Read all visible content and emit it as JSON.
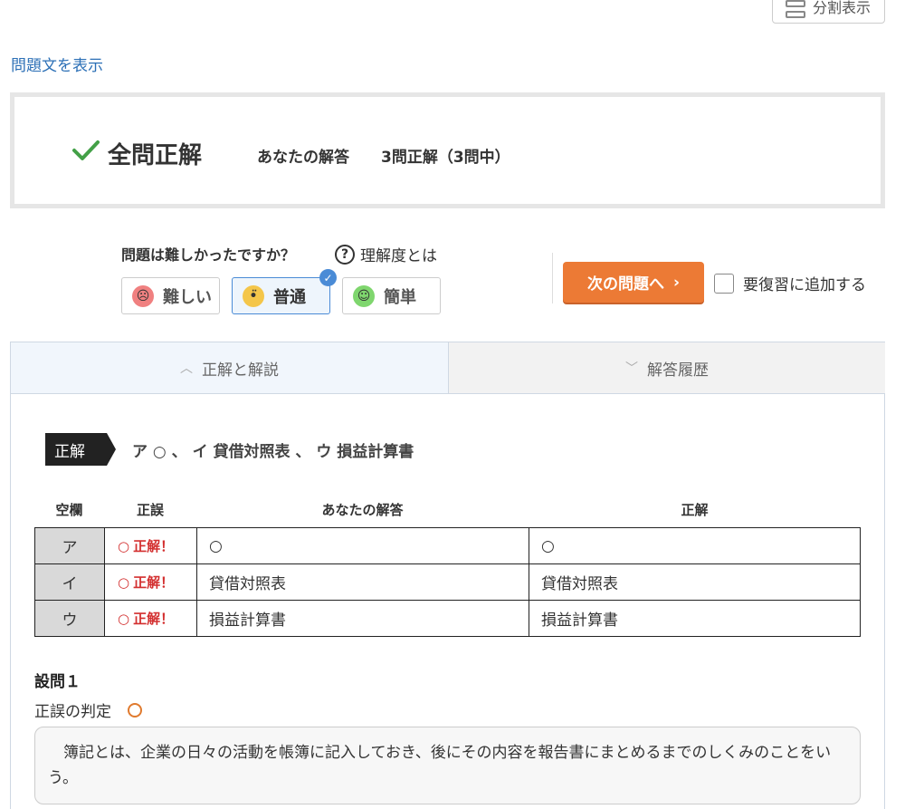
{
  "header": {
    "split_view_label": "分割表示",
    "show_question_link": "問題文を表示"
  },
  "result": {
    "title": "全問正解",
    "your_answer_label": "あなたの解答",
    "your_answer_value": "3問正解（3問中）"
  },
  "difficulty": {
    "question": "問題は難しかったですか？",
    "understanding_link": "理解度とは",
    "options": [
      {
        "label": "難しい",
        "face": "☹"
      },
      {
        "label": "普通",
        "face": "•̈"
      },
      {
        "label": "簡単",
        "face": "☺"
      }
    ],
    "selected": "普通"
  },
  "actions": {
    "next_button": "次の問題へ",
    "review_label": "要復習に追加する"
  },
  "tabs": [
    {
      "label": "正解と解説",
      "active": true
    },
    {
      "label": "解答履歴",
      "active": false
    }
  ],
  "answer": {
    "tag": "正解",
    "text": "ア ○ 、 イ 貸借対照表 、 ウ 損益計算書"
  },
  "table": {
    "headers": [
      "空欄",
      "正誤",
      "あなたの解答",
      "正解"
    ],
    "rows": [
      {
        "blank": "ア",
        "mark": "○",
        "judge": "正解！",
        "yours": "○",
        "correct": "○"
      },
      {
        "blank": "イ",
        "mark": "○",
        "judge": "正解！",
        "yours": "貸借対照表",
        "correct": "貸借対照表"
      },
      {
        "blank": "ウ",
        "mark": "○",
        "judge": "正解！",
        "yours": "損益計算書",
        "correct": "損益計算書"
      }
    ]
  },
  "question1": {
    "title": "設問１",
    "judge_label": "正誤の判定",
    "explanation": "簿記とは、企業の日々の活動を帳簿に記入しておき、後にその内容を報告書にまとめるまでのしくみのことをいう。"
  },
  "colors": {
    "accent_orange": "#ec7a35",
    "link_blue": "#2b6fb6",
    "check_green": "#43a047",
    "correct_red": "#d32f2f"
  }
}
